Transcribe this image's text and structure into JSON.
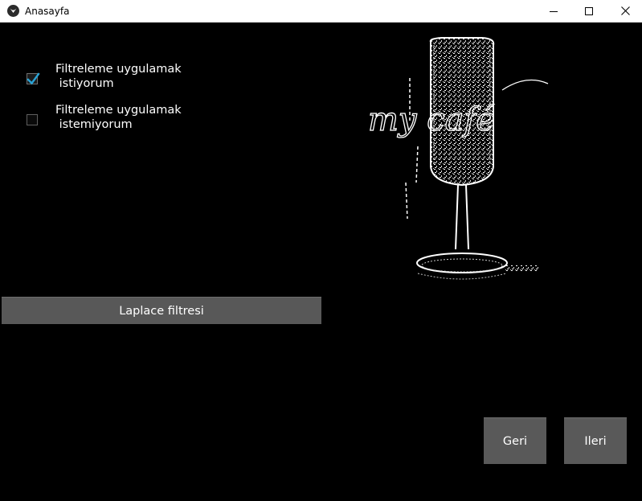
{
  "window": {
    "title": "Anasayfa"
  },
  "options": [
    {
      "label": "Filtreleme uygulamak\n istiyorum",
      "checked": true
    },
    {
      "label": "Filtreleme uygulamak\n istemiyorum",
      "checked": false
    }
  ],
  "actions": {
    "filter_button": "Laplace filtresi",
    "back_button": "Geri",
    "next_button": "Ileri"
  },
  "image": {
    "text": "my café"
  },
  "colors": {
    "background": "#000000",
    "button": "#585858",
    "check_accent": "#29a3d6"
  }
}
